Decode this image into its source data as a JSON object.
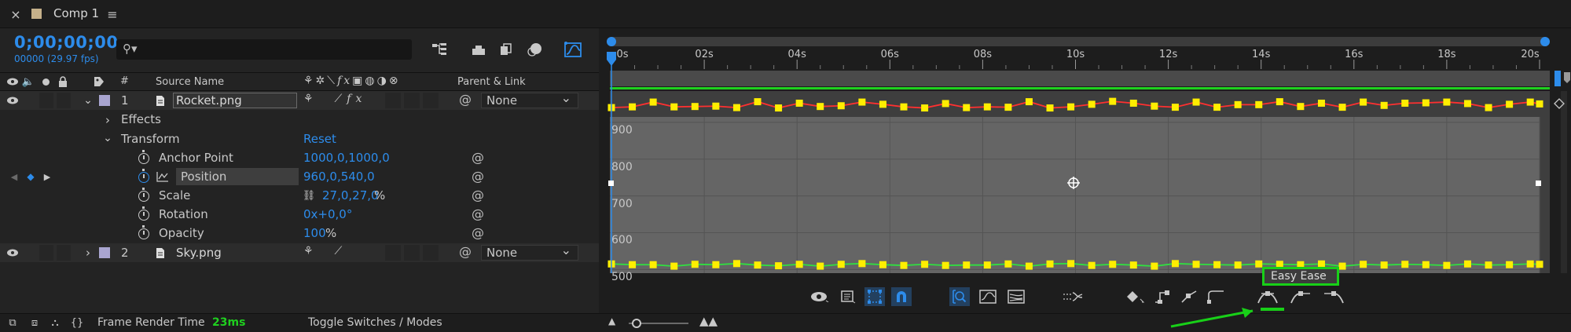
{
  "panel": {
    "close": "×",
    "comp_tab": "Comp 1",
    "menu": "≡"
  },
  "timecode": {
    "value": "0;00;00;00",
    "sub": "00000 (29.97 fps)"
  },
  "search": {
    "placeholder": ""
  },
  "columns": {
    "hash": "#",
    "source_name": "Source Name",
    "parent_link": "Parent & Link"
  },
  "layers": [
    {
      "index": "1",
      "name": "Rocket.png",
      "parent": "None",
      "color": "#a9a5d0"
    },
    {
      "index": "2",
      "name": "Sky.png",
      "parent": "None",
      "color": "#a9a5d0"
    }
  ],
  "groups": {
    "effects": "Effects",
    "transform": "Transform",
    "reset": "Reset"
  },
  "properties": [
    {
      "name": "Anchor Point",
      "value": "1000,0,1000,0"
    },
    {
      "name": "Position",
      "value": "960,0,540,0"
    },
    {
      "name": "Scale",
      "value": "27,0,27,0",
      "suffix": "%"
    },
    {
      "name": "Rotation",
      "value": "0x+0,0°"
    },
    {
      "name": "Opacity",
      "value": "100",
      "suffix": "%"
    }
  ],
  "status_bar": {
    "frame_render_label": "Frame Render Time",
    "frame_render_value": "23ms",
    "toggle_label": "Toggle Switches / Modes"
  },
  "tooltip": {
    "easy_ease": "Easy Ease"
  },
  "colors": {
    "accent_blue": "#2d8ceb",
    "keyframe_yellow": "#ffee00",
    "curve_red": "#ff3030",
    "curve_green": "#30e040",
    "highlight_green": "#18d018",
    "work_area_green": "#1fd01f"
  },
  "chart_data": {
    "type": "line",
    "title": "",
    "x_ticks": [
      "0s",
      "02s",
      "04s",
      "06s",
      "08s",
      "10s",
      "12s",
      "14s",
      "16s",
      "18s",
      "20s"
    ],
    "xlim": [
      0,
      20
    ],
    "xunit": "s",
    "y_ticks": [
      "900",
      "800",
      "700",
      "600",
      "500"
    ],
    "ylim": [
      490,
      985
    ],
    "grid": true,
    "series": [
      {
        "color": "#ff3030",
        "x": [
          0,
          0.45,
          0.9,
          1.35,
          1.8,
          2.25,
          2.7,
          3.15,
          3.6,
          4.05,
          4.5,
          4.95,
          5.4,
          5.85,
          6.3,
          6.75,
          7.2,
          7.65,
          8.1,
          8.55,
          9.0,
          9.45,
          9.9,
          10.35,
          10.8,
          11.25,
          11.7,
          12.15,
          12.6,
          13.05,
          13.5,
          13.95,
          14.4,
          14.85,
          15.3,
          15.75,
          16.2,
          16.65,
          17.1,
          17.55,
          18.0,
          18.45,
          18.9,
          19.35,
          19.8,
          20.0
        ],
        "y": [
          940,
          942,
          955,
          942,
          943,
          944,
          940,
          956,
          939,
          952,
          943,
          945,
          955,
          949,
          942,
          939,
          951,
          940,
          942,
          941,
          956,
          939,
          942,
          949,
          957,
          952,
          944,
          941,
          955,
          941,
          948,
          948,
          956,
          943,
          952,
          941,
          955,
          946,
          952,
          953,
          955,
          951,
          940,
          949,
          955,
          950
        ]
      },
      {
        "color": "#30e040",
        "x": [
          0,
          0.45,
          0.9,
          1.35,
          1.8,
          2.25,
          2.7,
          3.15,
          3.6,
          4.05,
          4.5,
          4.95,
          5.4,
          5.85,
          6.3,
          6.75,
          7.2,
          7.65,
          8.1,
          8.55,
          9.0,
          9.45,
          9.9,
          10.35,
          10.8,
          11.25,
          11.7,
          12.15,
          12.6,
          13.05,
          13.5,
          13.95,
          14.4,
          14.85,
          15.3,
          15.75,
          16.2,
          16.65,
          17.1,
          17.55,
          18.0,
          18.45,
          18.9,
          19.35,
          19.8,
          20.0
        ],
        "y": [
          515,
          513,
          513,
          509,
          514,
          513,
          516,
          512,
          510,
          514,
          509,
          514,
          516,
          513,
          511,
          514,
          511,
          512,
          512,
          515,
          509,
          515,
          516,
          511,
          514,
          512,
          509,
          516,
          514,
          513,
          512,
          515,
          514,
          513,
          515,
          509,
          514,
          512,
          514,
          513,
          511,
          515,
          512,
          513,
          515,
          514
        ]
      }
    ]
  }
}
